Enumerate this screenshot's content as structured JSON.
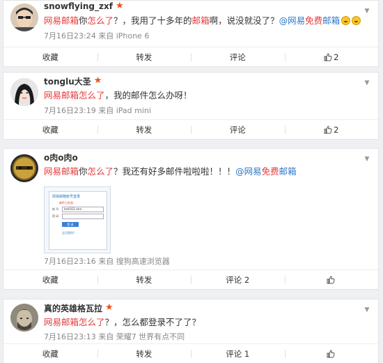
{
  "posts": [
    {
      "username": "snowflying_zxf",
      "text": [
        {
          "t": "网易邮箱",
          "c": "hl"
        },
        {
          "t": "你",
          "c": ""
        },
        {
          "t": "怎么了",
          "c": "hl"
        },
        {
          "t": "？，我用了十多年的",
          "c": ""
        },
        {
          "t": "邮箱",
          "c": "hl"
        },
        {
          "t": "啊，说没就没了？",
          "c": ""
        },
        {
          "t": "@网易",
          "c": "at"
        },
        {
          "t": "免费",
          "c": "hl"
        },
        {
          "t": "邮箱",
          "c": "at"
        }
      ],
      "meta": "7月16日23:24 来自 iPhone 6",
      "actions": {
        "collect": "收藏",
        "repost": "转发",
        "comment": "评论",
        "like": "2"
      }
    },
    {
      "username": "tonglu大圣",
      "text": [
        {
          "t": "网易邮箱怎么了",
          "c": "hl"
        },
        {
          "t": "，我的邮件怎么办呀！",
          "c": ""
        }
      ],
      "meta": "7月16日23:19 来自 iPad mini",
      "actions": {
        "collect": "收藏",
        "repost": "转发",
        "comment": "评论",
        "like": "2"
      }
    },
    {
      "username": "o肉o肉o",
      "text": [
        {
          "t": "网易邮箱",
          "c": "hl"
        },
        {
          "t": "你",
          "c": ""
        },
        {
          "t": "怎么了",
          "c": "hl"
        },
        {
          "t": "？我还有好多邮件啦啦啦！！！",
          "c": ""
        },
        {
          "t": "@网易",
          "c": "at"
        },
        {
          "t": "免费",
          "c": "hl"
        },
        {
          "t": "邮箱",
          "c": "at"
        }
      ],
      "screenshot": {
        "title": "网易邮箱帐号登录",
        "err": "邮件已失效",
        "field1": "帐  号",
        "field2": "密  码",
        "value": "test163.com",
        "btn": "登 录",
        "link": "忘记密码？"
      },
      "meta": "7月16日23:16 来自 搜狗高速浏览器",
      "actions": {
        "collect": "收藏",
        "repost": "转发",
        "comment": "评论 2",
        "like": ""
      }
    },
    {
      "username": "真的英雄格瓦拉",
      "text": [
        {
          "t": "网易邮箱怎么了",
          "c": "hl"
        },
        {
          "t": "？，怎么都登录不了了？",
          "c": ""
        }
      ],
      "meta": "7月16日23:13 来自 荣耀7 世界有点不同",
      "actions": {
        "collect": "收藏",
        "repost": "转发",
        "comment": "评论 1",
        "like": ""
      }
    }
  ],
  "colors": {
    "highlight": "#e7393b",
    "mention": "#2f77c9",
    "star": "#e8531f"
  },
  "icons": {
    "verified": "star-icon",
    "like": "thumbs-up-icon",
    "menu": "chevron-down-icon",
    "emoji": "laughing-emoji-icon"
  }
}
